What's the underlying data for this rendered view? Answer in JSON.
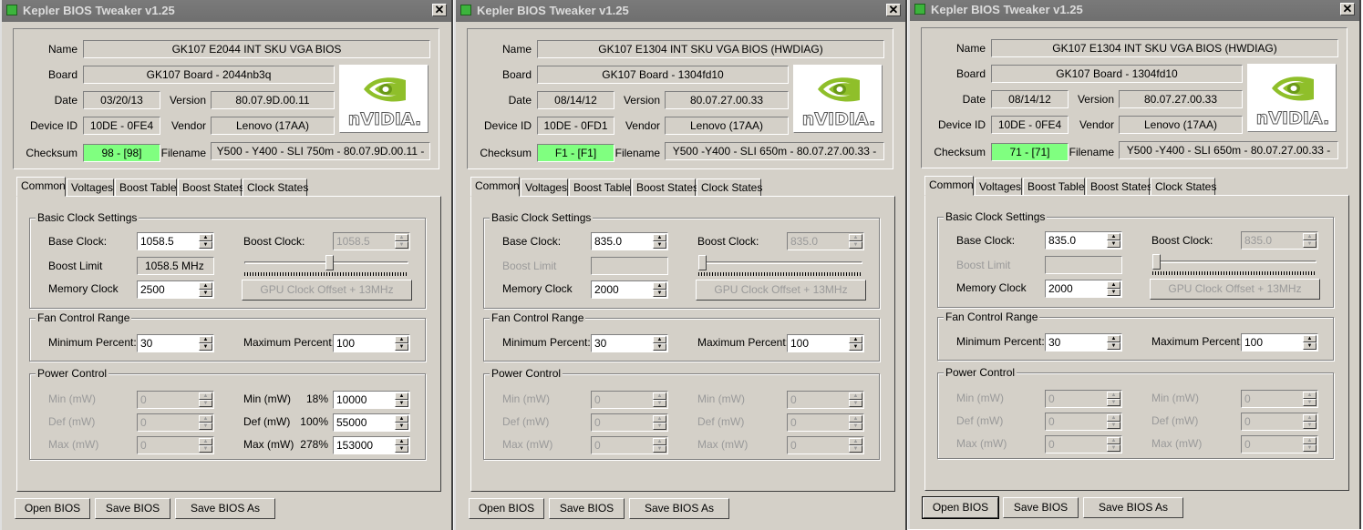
{
  "windows": [
    {
      "title": "Kepler BIOS Tweaker v1.25",
      "info": {
        "name_label": "Name",
        "name": "GK107 E2044 INT SKU VGA BIOS",
        "board_label": "Board",
        "board": "GK107 Board - 2044nb3q",
        "date_label": "Date",
        "date": "03/20/13",
        "version_label": "Version",
        "version": "80.07.9D.00.11",
        "device_label": "Device ID",
        "device_id": "10DE - 0FE4",
        "vendor_label": "Vendor",
        "vendor": "Lenovo (17AA)",
        "checksum_label": "Checksum",
        "checksum": "98 - [98]",
        "filename_label": "Filename",
        "filename": "Y500 - Y400 - SLI 750m - 80.07.9D.00.11 -"
      },
      "logo_text": "nVIDIA.",
      "tabs": [
        "Common",
        "Voltages",
        "Boost Table",
        "Boost States",
        "Clock States"
      ],
      "basic": {
        "title": "Basic Clock Settings",
        "base_clock_label": "Base Clock:",
        "base_clock": "1058.5",
        "boost_clock_label": "Boost Clock:",
        "boost_clock": "1058.5",
        "boost_limit_label": "Boost Limit",
        "boost_limit": "1058.5 MHz",
        "memory_clock_label": "Memory Clock",
        "memory_clock": "2500",
        "offset_button": "GPU Clock Offset + 13MHz",
        "slider_position": 0.52
      },
      "fan": {
        "title": "Fan Control Range",
        "min_label": "Minimum Percent:",
        "min": "30",
        "max_label": "Maximum Percent:",
        "max": "100"
      },
      "power": {
        "title": "Power Control",
        "left_min_label": "Min (mW)",
        "left_min": "0",
        "left_def_label": "Def (mW)",
        "left_def": "0",
        "left_max_label": "Max (mW)",
        "left_max": "0",
        "right_min_label": "Min (mW)",
        "right_min_pct": "18%",
        "right_min": "10000",
        "right_def_label": "Def (mW)",
        "right_def_pct": "100%",
        "right_def": "55000",
        "right_max_label": "Max (mW)",
        "right_max_pct": "278%",
        "right_max": "153000"
      },
      "buttons": {
        "open": "Open BIOS",
        "save": "Save BIOS",
        "save_as": "Save BIOS As"
      }
    },
    {
      "title": "Kepler BIOS Tweaker v1.25",
      "info": {
        "name_label": "Name",
        "name": "GK107 E1304 INT SKU VGA BIOS (HWDIAG)",
        "board_label": "Board",
        "board": "GK107 Board - 1304fd10",
        "date_label": "Date",
        "date": "08/14/12",
        "version_label": "Version",
        "version": "80.07.27.00.33",
        "device_label": "Device ID",
        "device_id": "10DE - 0FD1",
        "vendor_label": "Vendor",
        "vendor": "Lenovo (17AA)",
        "checksum_label": "Checksum",
        "checksum": "F1 - [F1]",
        "filename_label": "Filename",
        "filename": "Y500 -Y400 - SLI 650m - 80.07.27.00.33 -"
      },
      "logo_text": "nVIDIA.",
      "tabs": [
        "Common",
        "Voltages",
        "Boost Table",
        "Boost States",
        "Clock States"
      ],
      "basic": {
        "title": "Basic Clock Settings",
        "base_clock_label": "Base Clock:",
        "base_clock": "835.0",
        "boost_clock_label": "Boost Clock:",
        "boost_clock": "835.0",
        "boost_limit_label": "Boost Limit",
        "boost_limit": "",
        "memory_clock_label": "Memory Clock",
        "memory_clock": "2000",
        "offset_button": "GPU Clock Offset + 13MHz",
        "slider_position": 0.0
      },
      "fan": {
        "title": "Fan Control Range",
        "min_label": "Minimum Percent:",
        "min": "30",
        "max_label": "Maximum Percent:",
        "max": "100"
      },
      "power": {
        "title": "Power Control",
        "left_min_label": "Min (mW)",
        "left_min": "0",
        "left_def_label": "Def (mW)",
        "left_def": "0",
        "left_max_label": "Max (mW)",
        "left_max": "0",
        "right_min_label": "Min (mW)",
        "right_min_pct": "",
        "right_min": "0",
        "right_def_label": "Def (mW)",
        "right_def_pct": "",
        "right_def": "0",
        "right_max_label": "Max (mW)",
        "right_max_pct": "",
        "right_max": "0"
      },
      "buttons": {
        "open": "Open BIOS",
        "save": "Save BIOS",
        "save_as": "Save BIOS As"
      }
    },
    {
      "title": "Kepler BIOS Tweaker v1.25",
      "info": {
        "name_label": "Name",
        "name": "GK107 E1304 INT SKU VGA BIOS (HWDIAG)",
        "board_label": "Board",
        "board": "GK107 Board - 1304fd10",
        "date_label": "Date",
        "date": "08/14/12",
        "version_label": "Version",
        "version": "80.07.27.00.33",
        "device_label": "Device ID",
        "device_id": "10DE - 0FE4",
        "vendor_label": "Vendor",
        "vendor": "Lenovo (17AA)",
        "checksum_label": "Checksum",
        "checksum": "71 - [71]",
        "filename_label": "Filename",
        "filename": "Y500 -Y400 - SLI 650m - 80.07.27.00.33 -"
      },
      "logo_text": "nVIDIA.",
      "tabs": [
        "Common",
        "Voltages",
        "Boost Table",
        "Boost States",
        "Clock States"
      ],
      "basic": {
        "title": "Basic Clock Settings",
        "base_clock_label": "Base Clock:",
        "base_clock": "835.0",
        "boost_clock_label": "Boost Clock:",
        "boost_clock": "835.0",
        "boost_limit_label": "Boost Limit",
        "boost_limit": "",
        "memory_clock_label": "Memory Clock",
        "memory_clock": "2000",
        "offset_button": "GPU Clock Offset + 13MHz",
        "slider_position": 0.0
      },
      "fan": {
        "title": "Fan Control Range",
        "min_label": "Minimum Percent:",
        "min": "30",
        "max_label": "Maximum Percent:",
        "max": "100"
      },
      "power": {
        "title": "Power Control",
        "left_min_label": "Min (mW)",
        "left_min": "0",
        "left_def_label": "Def (mW)",
        "left_def": "0",
        "left_max_label": "Max (mW)",
        "left_max": "0",
        "right_min_label": "Min (mW)",
        "right_min_pct": "",
        "right_min": "0",
        "right_def_label": "Def (mW)",
        "right_def_pct": "",
        "right_def": "0",
        "right_max_label": "Max (mW)",
        "right_max_pct": "",
        "right_max": "0"
      },
      "buttons": {
        "open": "Open BIOS",
        "save": "Save BIOS",
        "save_as": "Save BIOS As"
      }
    }
  ]
}
